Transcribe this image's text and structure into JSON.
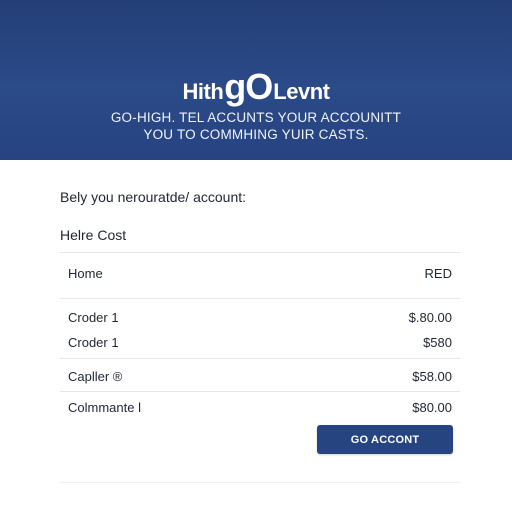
{
  "theme": {
    "accent": "#26447f",
    "header_bg": "#2b4a88",
    "text": "#1f2530",
    "divider": "#e4e7ec"
  },
  "header": {
    "brand_prefix": "Hith",
    "brand_mark": "gO",
    "brand_suffix": "Levnt",
    "line1": "GO-HIGH. TEL ACCUNTS YOUR ACCOUNITT",
    "line2": "YOU TO COMMHING YUIR CASTS."
  },
  "main": {
    "intro": "Bely you nerouratde/ account:",
    "section_title": "Helre Cost",
    "table": {
      "header": {
        "left": "Home",
        "right": "RED"
      },
      "rows": [
        {
          "label": "Croder 1",
          "value": "$.80.00"
        },
        {
          "label": "Croder 1",
          "value": "$580"
        },
        {
          "label": "Capller ®",
          "value": "$58.00"
        },
        {
          "label": "Colmmante l",
          "value": "$80.00"
        }
      ]
    },
    "cta_label": "GO ACCONT"
  }
}
